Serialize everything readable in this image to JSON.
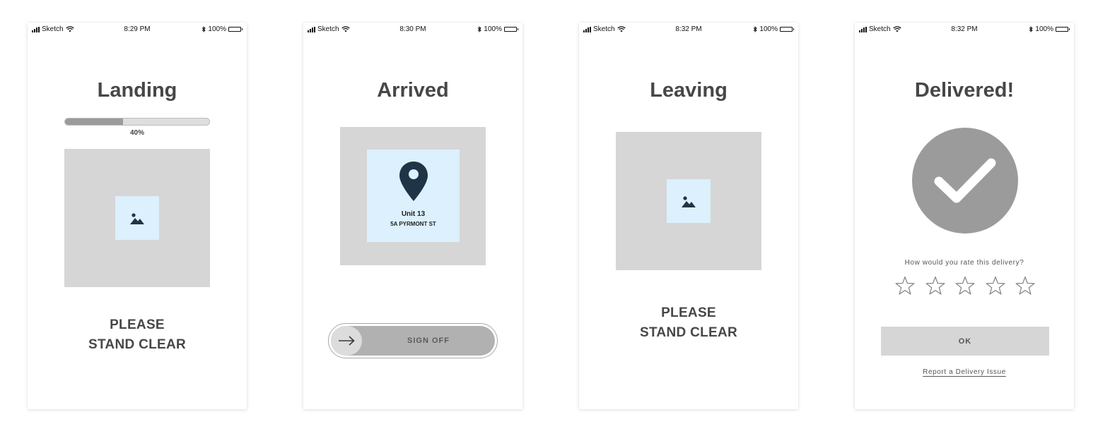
{
  "screens": [
    {
      "status": {
        "carrier": "Sketch",
        "time": "8:29 PM",
        "battery": "100%"
      },
      "title": "Landing",
      "progress": {
        "value_percent": 40,
        "label": "40%"
      },
      "image_icon": "image-icon",
      "message_line1": "PLEASE",
      "message_line2": "STAND CLEAR"
    },
    {
      "status": {
        "carrier": "Sketch",
        "time": "8:30 PM",
        "battery": "100%"
      },
      "title": "Arrived",
      "location_icon": "map-pin-icon",
      "unit": "Unit 13",
      "address": "5A PYRMONT ST",
      "slider_icon": "arrow-right-icon",
      "slider_label": "SIGN OFF"
    },
    {
      "status": {
        "carrier": "Sketch",
        "time": "8:32 PM",
        "battery": "100%"
      },
      "title": "Leaving",
      "image_icon": "image-icon",
      "message_line1": "PLEASE",
      "message_line2": "STAND CLEAR"
    },
    {
      "status": {
        "carrier": "Sketch",
        "time": "8:32 PM",
        "battery": "100%"
      },
      "title": "Delivered!",
      "check_icon": "checkmark-icon",
      "rating_question": "How would you rate this delivery?",
      "rating": {
        "selected": 0,
        "max": 5
      },
      "ok_label": "OK",
      "report_link": "Report a Delivery Issue"
    }
  ],
  "colors": {
    "heading": "#474747",
    "grey_box": "#d6d6d6",
    "image_tile": "#dcf0fd",
    "pin": "#1f3447",
    "check_circle": "#9b9b9b"
  }
}
